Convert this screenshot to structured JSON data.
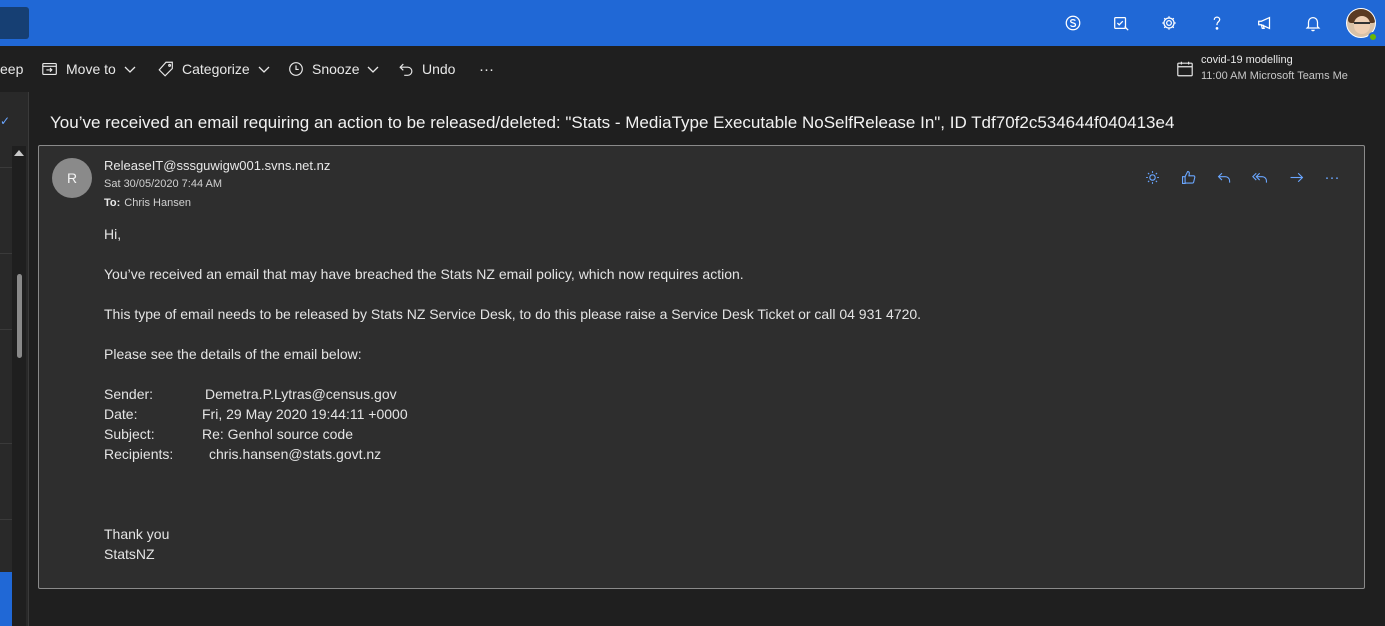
{
  "toolbar": {
    "sweep_label": "eep",
    "move_to_label": "Move to",
    "categorize_label": "Categorize",
    "snooze_label": "Snooze",
    "undo_label": "Undo",
    "more_label": "···"
  },
  "reminder": {
    "title": "covid-19 modelling",
    "detail": "11:00 AM Microsoft Teams Me"
  },
  "header_icons": [
    "skype-icon",
    "tasks-icon",
    "settings-icon",
    "help-icon",
    "feedback-icon",
    "bell-icon",
    "avatar"
  ],
  "message": {
    "subject": "You’ve received an email requiring an action to be released/deleted: \"Stats - MediaType Executable NoSelfRelease In\", ID Tdf70f2c534644f040413e4",
    "sender_initial": "R",
    "from": "ReleaseIT@sssguwigw001.svns.net.nz",
    "date": "Sat 30/05/2020 7:44 AM",
    "to_label": "To:",
    "to": "Chris Hansen",
    "body": {
      "greeting": "Hi,",
      "p1": "You’ve received an email that may have breached the Stats NZ email policy, which now requires action.",
      "p2": "This type of email needs to be released by Stats NZ Service Desk, to do this please raise a Service Desk Ticket or call 04 931 4720.",
      "p3": "Please see the details of the email below:",
      "details": [
        {
          "label": "Sender:",
          "value": "Demetra.P.Lytras@census.gov"
        },
        {
          "label": "Date:",
          "value": "Fri, 29 May 2020 19:44:11 +0000"
        },
        {
          "label": "Subject:",
          "value": "Re: Genhol source code"
        },
        {
          "label": "Recipients:",
          "value": "chris.hansen@stats.govt.nz"
        }
      ],
      "closing1": "Thank you",
      "closing2": "StatsNZ"
    }
  },
  "colors": {
    "topbar": "#2068d6",
    "accent": "#6aa6ff",
    "background": "#1f1f1f",
    "card": "#2e2e2e"
  }
}
